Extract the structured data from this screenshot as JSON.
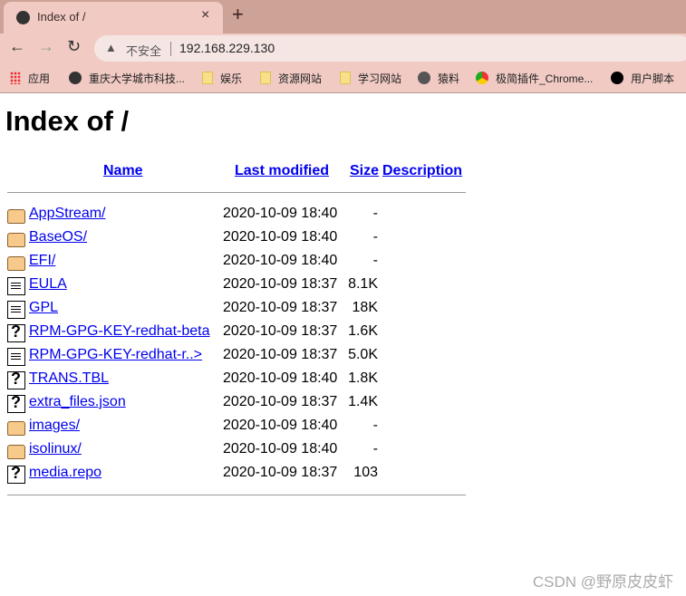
{
  "browser": {
    "tab_title": "Index of /",
    "new_tab": "+",
    "close": "×",
    "back": "←",
    "forward": "→",
    "reload": "↻",
    "insecure_label": "不安全",
    "url": "192.168.229.130",
    "bookmarks": [
      {
        "label": "应用",
        "icon": "apps-icon"
      },
      {
        "label": "重庆大学城市科技...",
        "icon": "globe-icon"
      },
      {
        "label": "娱乐",
        "icon": "folder-icon"
      },
      {
        "label": "资源网站",
        "icon": "folder-icon"
      },
      {
        "label": "学习网站",
        "icon": "folder-icon"
      },
      {
        "label": "猿料",
        "icon": "site-icon"
      },
      {
        "label": "极简插件_Chrome...",
        "icon": "store-icon"
      },
      {
        "label": "用户脚本",
        "icon": "script-icon"
      }
    ]
  },
  "page": {
    "title": "Index of /",
    "headers": {
      "name": "Name",
      "modified": "Last modified",
      "size": "Size",
      "description": "Description"
    },
    "rows": [
      {
        "name": "AppStream/",
        "date": "2020-10-09 18:40",
        "size": "-",
        "type": "folder"
      },
      {
        "name": "BaseOS/",
        "date": "2020-10-09 18:40",
        "size": "-",
        "type": "folder"
      },
      {
        "name": "EFI/",
        "date": "2020-10-09 18:40",
        "size": "-",
        "type": "folder"
      },
      {
        "name": "EULA",
        "date": "2020-10-09 18:37",
        "size": "8.1K",
        "type": "text"
      },
      {
        "name": "GPL",
        "date": "2020-10-09 18:37",
        "size": "18K",
        "type": "text"
      },
      {
        "name": "RPM-GPG-KEY-redhat-beta",
        "date": "2020-10-09 18:37",
        "size": "1.6K",
        "type": "unknown"
      },
      {
        "name": "RPM-GPG-KEY-redhat-r..>",
        "date": "2020-10-09 18:37",
        "size": "5.0K",
        "type": "text"
      },
      {
        "name": "TRANS.TBL",
        "date": "2020-10-09 18:40",
        "size": "1.8K",
        "type": "unknown"
      },
      {
        "name": "extra_files.json",
        "date": "2020-10-09 18:37",
        "size": "1.4K",
        "type": "unknown"
      },
      {
        "name": "images/",
        "date": "2020-10-09 18:40",
        "size": "-",
        "type": "folder"
      },
      {
        "name": "isolinux/",
        "date": "2020-10-09 18:40",
        "size": "-",
        "type": "folder"
      },
      {
        "name": "media.repo",
        "date": "2020-10-09 18:37",
        "size": "103",
        "type": "unknown"
      }
    ]
  },
  "watermark": "CSDN @野原皮皮虾"
}
